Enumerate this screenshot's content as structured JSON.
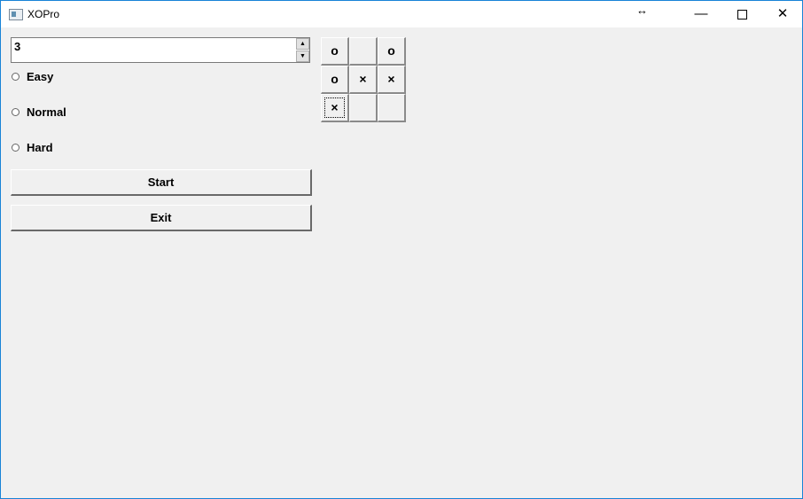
{
  "window": {
    "title": "XOPro"
  },
  "titlebar_icons": {
    "resize": "↔",
    "minimize": "—",
    "close": "✕"
  },
  "spinner": {
    "value": "3",
    "up": "▲",
    "down": "▼"
  },
  "difficulty": {
    "options": [
      "Easy",
      "Normal",
      "Hard"
    ]
  },
  "buttons": {
    "start": "Start",
    "exit": "Exit"
  },
  "board": {
    "cells": [
      "o",
      "",
      "o",
      "o",
      "×",
      "×",
      "×",
      "",
      ""
    ]
  }
}
